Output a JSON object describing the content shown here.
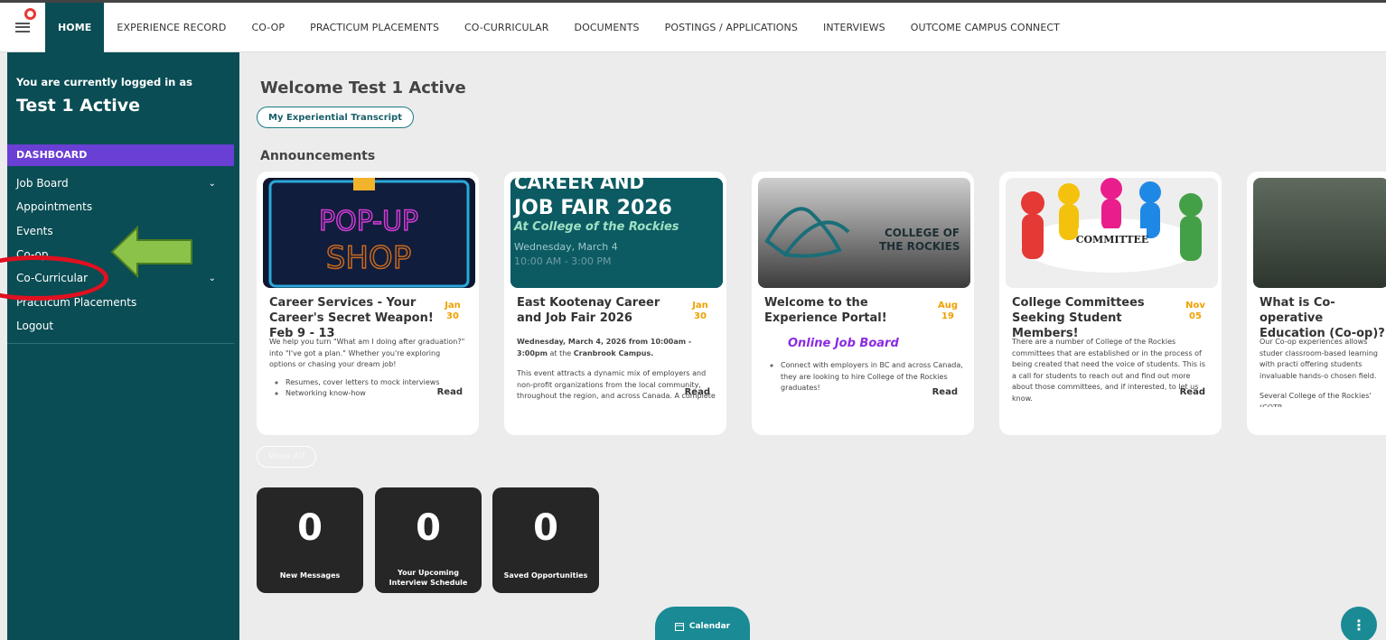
{
  "nav": {
    "items": [
      "HOME",
      "EXPERIENCE RECORD",
      "CO-OP",
      "PRACTICUM PLACEMENTS",
      "CO-CURRICULAR",
      "DOCUMENTS",
      "POSTINGS / APPLICATIONS",
      "INTERVIEWS",
      "OUTCOME CAMPUS CONNECT"
    ],
    "active_index": 0
  },
  "sidebar": {
    "logged_in_label": "You are currently logged in as",
    "user_name": "Test 1 Active",
    "dashboard": "DASHBOARD",
    "items": [
      {
        "label": "Job Board",
        "has_submenu": true
      },
      {
        "label": "Appointments",
        "has_submenu": false
      },
      {
        "label": "Events",
        "has_submenu": false
      },
      {
        "label": "Co-op",
        "has_submenu": false
      },
      {
        "label": "Co-Curricular",
        "has_submenu": true
      },
      {
        "label": "Practicum Placements",
        "has_submenu": false
      },
      {
        "label": "Logout",
        "has_submenu": false
      }
    ]
  },
  "main": {
    "welcome": "Welcome Test 1 Active",
    "transcript_button": "My Experiential Transcript",
    "announcements_title": "Announcements",
    "view_all": "View All",
    "cards": [
      {
        "image_text": [
          "POP-UP",
          "SHOP"
        ],
        "title": "Career Services - Your Career's Secret Weapon! Feb 9 - 13",
        "date": "Jan 30",
        "body_intro": "We help you turn \"What am I doing after graduation?\" into \"I've got a plan.\" Whether you're exploring options or chasing your dream job!",
        "bullets": [
          "Resumes, cover letters to mock interviews",
          "Networking know-how"
        ],
        "read": "Read"
      },
      {
        "image_text": [
          "CAREER AND",
          "JOB FAIR 2026",
          "At College of the Rockies",
          "Wednesday, March 4",
          "10:00 AM - 3:00 PM"
        ],
        "title": "East Kootenay Career and Job Fair 2026",
        "date": "Jan 30",
        "body_bold": "Wednesday, March 4, 2026 from 10:00am - 3:00pm",
        "body_after_bold": " at the ",
        "body_bold2": "Cranbrook Campus.",
        "body_p2": "This event attracts a dynamic mix of employers and non-profit organizations from the local community, throughout the region, and across Canada. A complete",
        "read": "Read"
      },
      {
        "image_text": [
          "COLLEGE OF",
          "THE ROCKIES"
        ],
        "title": "Welcome to the Experience Portal!",
        "date": "Aug 19",
        "highlight": "Online Job Board",
        "bullets": [
          "Connect with employers in BC and across Canada, they are looking to hire College of the Rockies graduates!"
        ],
        "read": "Read"
      },
      {
        "image_text": [
          "COMMITTEE"
        ],
        "title": "College Committees Seeking Student Members!",
        "date": "Nov 05",
        "body_intro": "There are a number of College of the Rockies committees that are established or in the process of being created that need the voice of students. This is a call for students to reach out and find out more about those committees, and if interested, to let us know.",
        "read": "Read"
      },
      {
        "title": "What is Co-operative Education (Co-op)?",
        "body_intro": "Our Co-op experiences allows studer classroom-based learning with practi offering students invaluable hands-o chosen field.",
        "body_p2": "Several College of the Rockies' (COTR"
      }
    ],
    "stats": [
      {
        "value": "0",
        "label": "New Messages"
      },
      {
        "value": "0",
        "label": "Your Upcoming Interview Schedule"
      },
      {
        "value": "0",
        "label": "Saved Opportunities"
      }
    ],
    "calendar_button": "Calendar",
    "fab_icon": "more-vertical-icon"
  },
  "colors": {
    "sidebar": "#0a4d54",
    "dashboard_highlight": "#6a3fd4",
    "accent": "#1a8a95",
    "date": "#f0a000",
    "annotation_circle": "#e01020",
    "annotation_arrow": "#8bc34a"
  }
}
